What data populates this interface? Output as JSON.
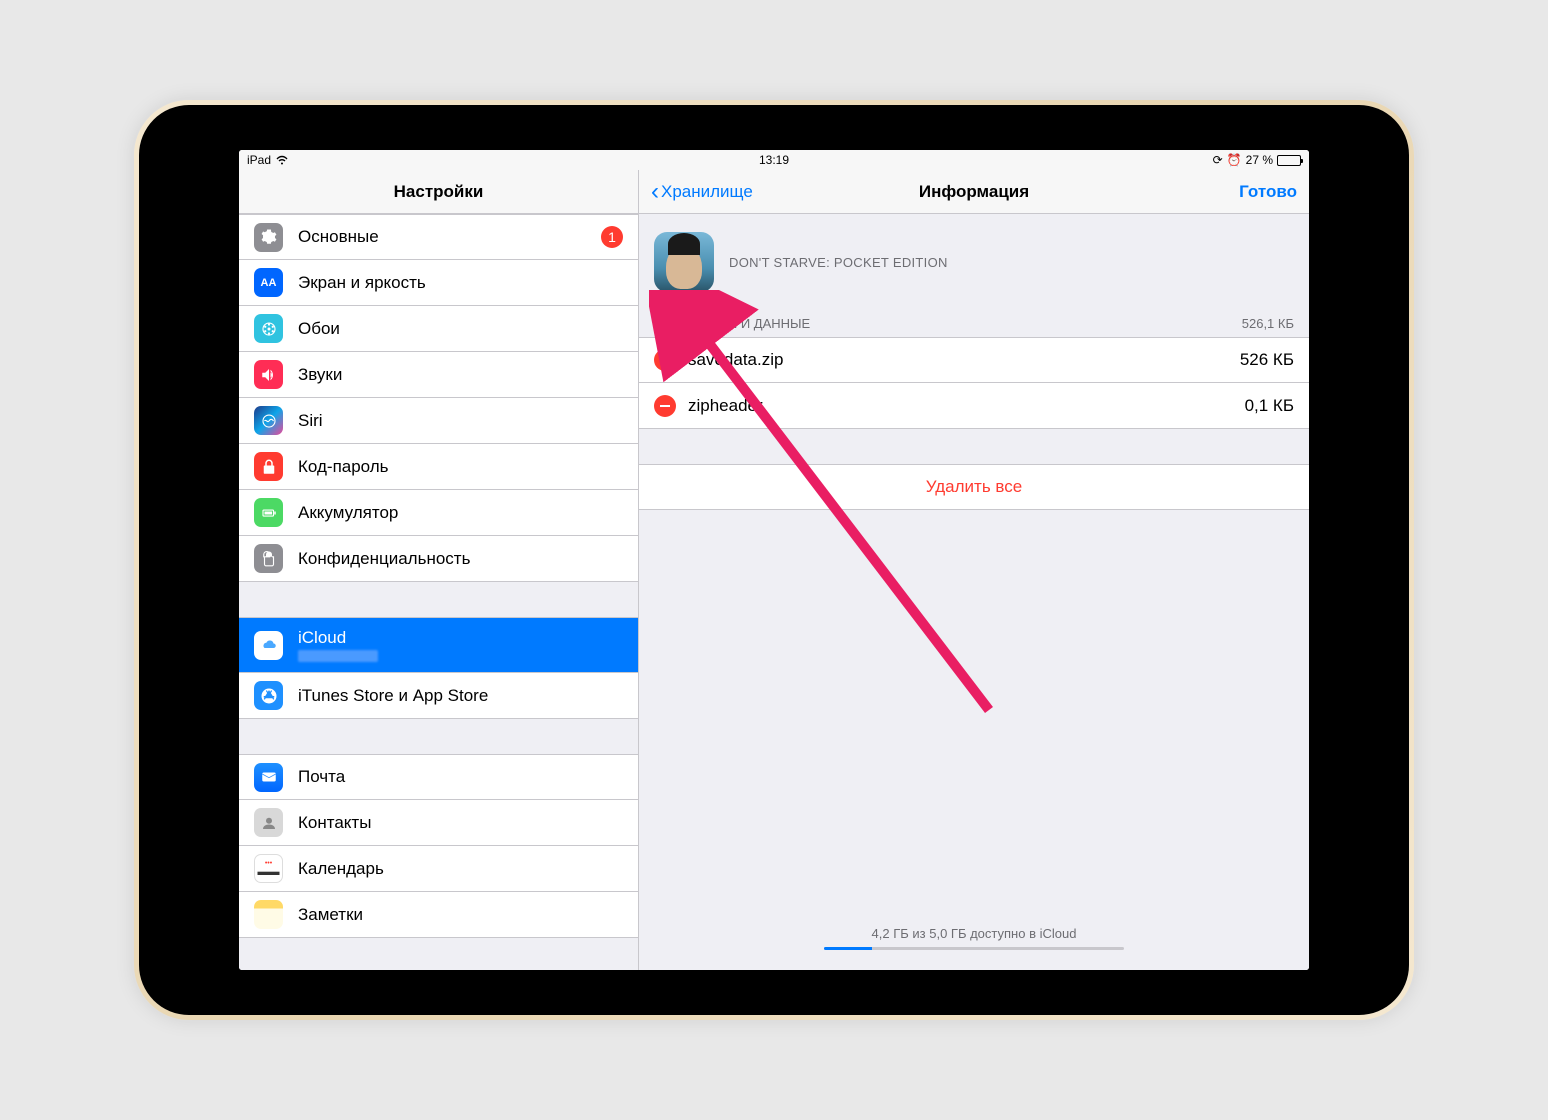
{
  "status": {
    "device": "iPad",
    "time": "13:19",
    "battery_text": "27 %"
  },
  "sidebar": {
    "title": "Настройки",
    "groups": [
      [
        {
          "key": "general",
          "label": "Основные",
          "badge": "1"
        },
        {
          "key": "display",
          "label": "Экран и яркость"
        },
        {
          "key": "wallpaper",
          "label": "Обои"
        },
        {
          "key": "sounds",
          "label": "Звуки"
        },
        {
          "key": "siri",
          "label": "Siri"
        },
        {
          "key": "passcode",
          "label": "Код-пароль"
        },
        {
          "key": "battery",
          "label": "Аккумулятор"
        },
        {
          "key": "privacy",
          "label": "Конфиденциальность"
        }
      ],
      [
        {
          "key": "icloud",
          "label": "iCloud",
          "selected": true
        },
        {
          "key": "appstore",
          "label": "iTunes Store и App Store"
        }
      ],
      [
        {
          "key": "mail",
          "label": "Почта"
        },
        {
          "key": "contacts",
          "label": "Контакты"
        },
        {
          "key": "calendar",
          "label": "Календарь"
        },
        {
          "key": "notes",
          "label": "Заметки"
        }
      ]
    ]
  },
  "detail": {
    "back_label": "Хранилище",
    "title": "Информация",
    "done_label": "Готово",
    "app_name": "DON'T STARVE: POCKET EDITION",
    "section_header": "ДОКУМЕНТЫ И ДАННЫЕ",
    "section_size": "526,1 КБ",
    "documents": [
      {
        "name": "savedata.zip",
        "size": "526 КБ"
      },
      {
        "name": "zipheader",
        "size": "0,1 КБ"
      }
    ],
    "delete_all": "Удалить все",
    "storage_text": "4,2 ГБ из 5,0 ГБ доступно в iCloud"
  }
}
